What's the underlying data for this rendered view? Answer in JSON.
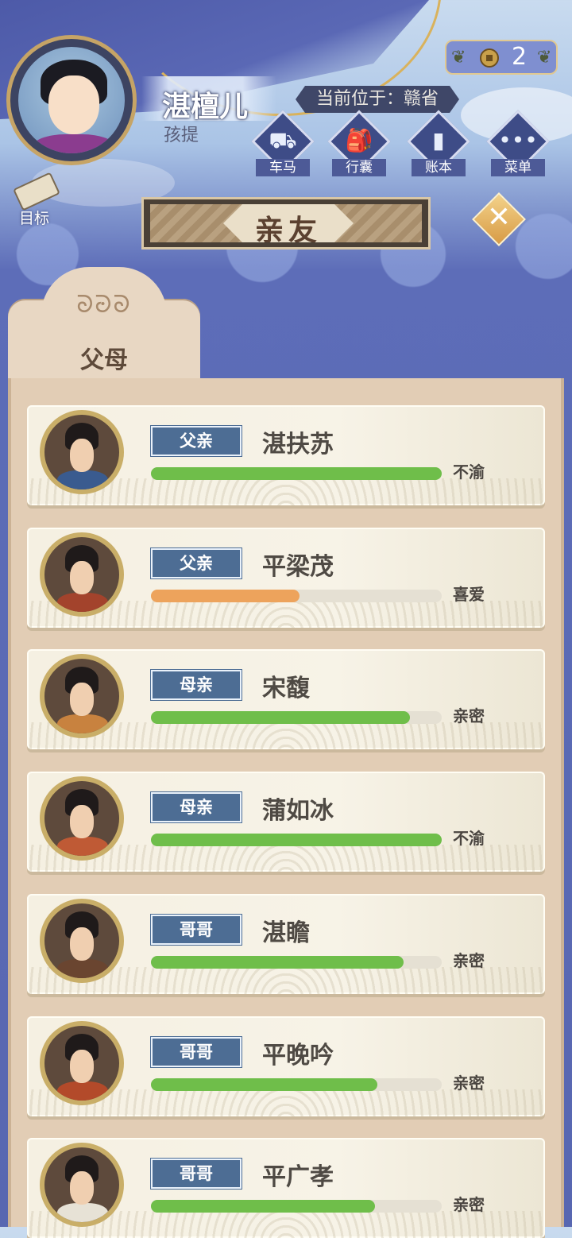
{
  "player": {
    "name": "湛檀儿",
    "title": "孩提"
  },
  "location": "当前位于：赣省",
  "currency": {
    "count": "2",
    "icon": "coin-icon"
  },
  "menu": [
    {
      "label": "车马",
      "icon": "carriage-icon",
      "glyph": "⛟"
    },
    {
      "label": "行囊",
      "icon": "bag-icon",
      "glyph": "🎒"
    },
    {
      "label": "账本",
      "icon": "ledger-icon",
      "glyph": "▮"
    },
    {
      "label": "菜单",
      "icon": "menu-icon",
      "glyph": "•••"
    }
  ],
  "goal_label": "目标",
  "page_title": "亲友",
  "tab_label": "父母",
  "tab_swirl": "ᘐᘒᘐ",
  "colors": {
    "bar_green": "#6fbe4a",
    "bar_orange": "#eda35c"
  },
  "relatives": [
    {
      "relation": "父亲",
      "name": "湛扶苏",
      "attitude": "不渝",
      "level": 1.0,
      "color": "green",
      "robe": "#3a5b8f"
    },
    {
      "relation": "父亲",
      "name": "平梁茂",
      "attitude": "喜爱",
      "level": 0.51,
      "color": "orange",
      "robe": "#a3432c"
    },
    {
      "relation": "母亲",
      "name": "宋馥",
      "attitude": "亲密",
      "level": 0.89,
      "color": "green",
      "robe": "#c8823f"
    },
    {
      "relation": "母亲",
      "name": "蒲如冰",
      "attitude": "不渝",
      "level": 1.0,
      "color": "green",
      "robe": "#bf5a35"
    },
    {
      "relation": "哥哥",
      "name": "湛瞻",
      "attitude": "亲密",
      "level": 0.87,
      "color": "green",
      "robe": "#6a4530"
    },
    {
      "relation": "哥哥",
      "name": "平晚吟",
      "attitude": "亲密",
      "level": 0.78,
      "color": "green",
      "robe": "#b34a2a"
    },
    {
      "relation": "哥哥",
      "name": "平广孝",
      "attitude": "亲密",
      "level": 0.77,
      "color": "green",
      "robe": "#e7e2d6"
    }
  ]
}
